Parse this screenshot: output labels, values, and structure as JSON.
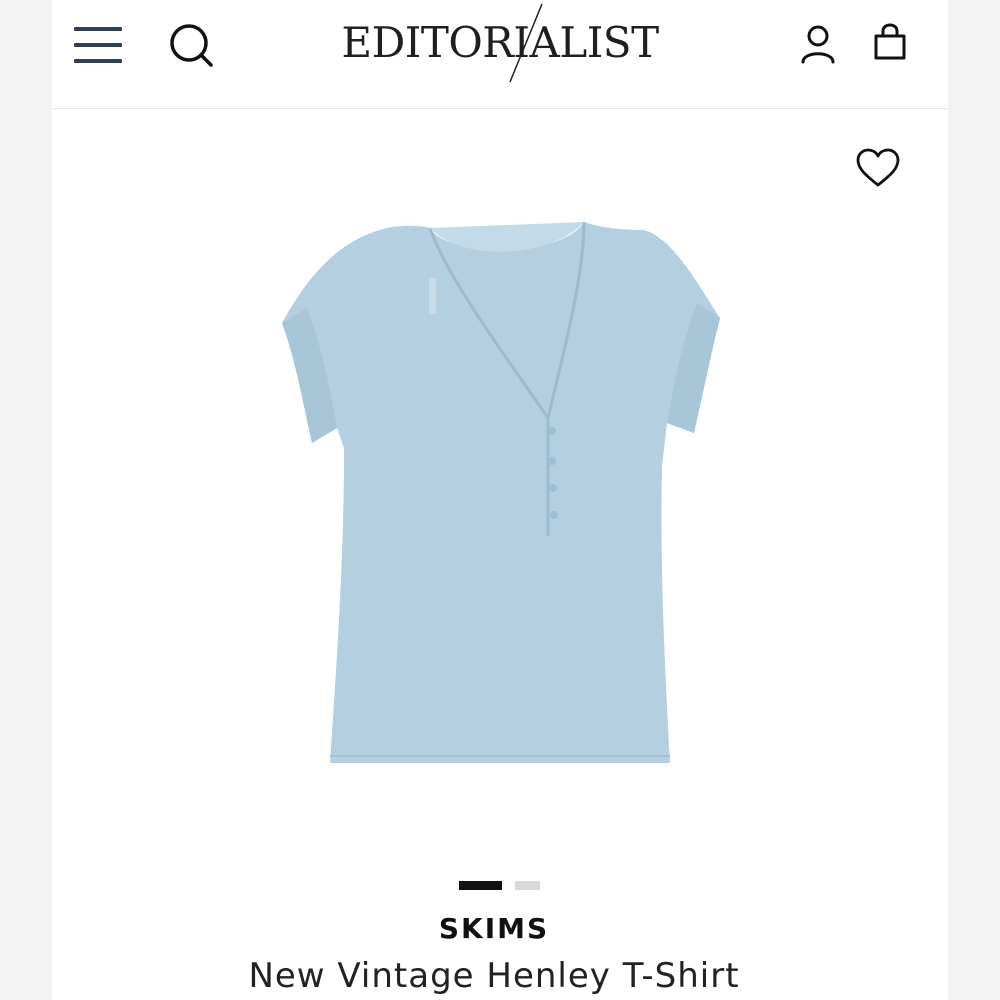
{
  "header": {
    "logo_text": "EDITORIALIST",
    "menu_icon": "hamburger-menu-icon",
    "search_icon": "search-icon",
    "account_icon": "user-icon",
    "bag_icon": "shopping-bag-icon",
    "text_color": "#2f3f4b"
  },
  "product": {
    "wishlist_icon": "heart-icon",
    "image_description_icon": "blue-henley-tshirt-image",
    "garment_color": "#b3cfe0",
    "carousel": {
      "total": 2,
      "active_index": 1
    },
    "brand": "SKIMS",
    "name": "New Vintage Henley T-Shirt"
  }
}
